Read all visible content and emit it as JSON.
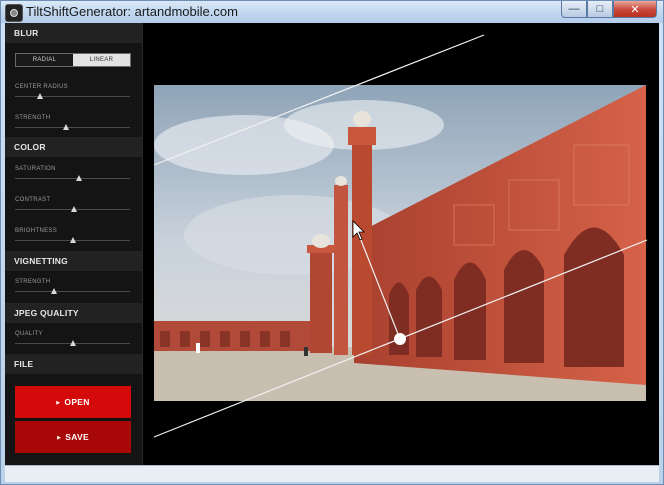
{
  "window": {
    "title": "TiltShiftGenerator: artandmobile.com",
    "controls": {
      "minimize": "—",
      "maximize": "□",
      "close": "✕"
    }
  },
  "sidebar": {
    "blur": {
      "header": "BLUR",
      "mode_options": [
        "RADIAL",
        "LINEAR"
      ],
      "selected_mode": "LINEAR",
      "sliders": [
        {
          "label": "CENTER RADIUS",
          "value": 0.22
        },
        {
          "label": "STRENGTH",
          "value": 0.44
        }
      ]
    },
    "color": {
      "header": "COLOR",
      "sliders": [
        {
          "label": "SATURATION",
          "value": 0.56
        },
        {
          "label": "CONTRAST",
          "value": 0.51
        },
        {
          "label": "BRIGHTNESS",
          "value": 0.5
        }
      ]
    },
    "vignetting": {
      "header": "VIGNETTING",
      "sliders": [
        {
          "label": "STRENGTH",
          "value": 0.34
        }
      ]
    },
    "jpeg": {
      "header": "JPEG QUALITY",
      "sliders": [
        {
          "label": "QUALITY",
          "value": 0.5
        }
      ]
    },
    "file": {
      "header": "FILE",
      "open_label": "OPEN",
      "save_label": "SAVE"
    }
  },
  "colors": {
    "open_button": "#d40a0a",
    "save_button": "#a80707",
    "sidebar_bg": "#141414",
    "mosque_red": "#c4503c"
  },
  "icons": {
    "app": "camera-icon",
    "button_arrow": "triangle-right-icon",
    "cursor": "pointer-arrow-icon"
  }
}
